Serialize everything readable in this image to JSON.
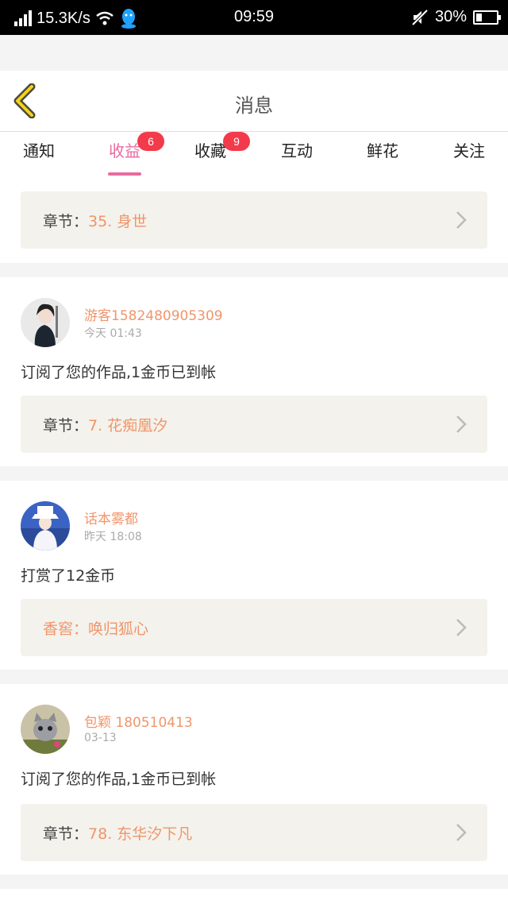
{
  "status_bar": {
    "speed": "15.3K/s",
    "time": "09:59",
    "battery_percent": "30%",
    "battery_level": 0.3
  },
  "header": {
    "title": "消息"
  },
  "tabs": [
    {
      "label": "通知"
    },
    {
      "label": "收益",
      "badge": "6",
      "active": true
    },
    {
      "label": "收藏",
      "badge": "9"
    },
    {
      "label": "互动"
    },
    {
      "label": "鲜花"
    },
    {
      "label": "关注"
    }
  ],
  "cards": [
    {
      "chapter": {
        "label": "章节：",
        "value": "35. 身世"
      }
    },
    {
      "user": {
        "name": "游客1582480905309",
        "time": "今天 01:43"
      },
      "action": "订阅了您的作品,1金币已到帐",
      "chapter": {
        "label": "章节：",
        "value": "7. 花痴凰汐"
      }
    },
    {
      "user": {
        "name": "话本雾都",
        "time": "昨天 18:08"
      },
      "action": "打赏了12金币",
      "chapter": {
        "label": "香窖：",
        "value": "唤归狐心"
      }
    },
    {
      "user": {
        "name": "包颖 180510413",
        "time": "03-13"
      },
      "action": "订阅了您的作品,1金币已到帐",
      "chapter": {
        "label": "章节：",
        "value": "78. 东华汐下凡"
      }
    }
  ],
  "colors": {
    "accent_pink": "#e86b9f",
    "badge_red": "#f23a4a",
    "orange_text": "#f0956a",
    "chapter_bg": "#f4f2ec"
  }
}
